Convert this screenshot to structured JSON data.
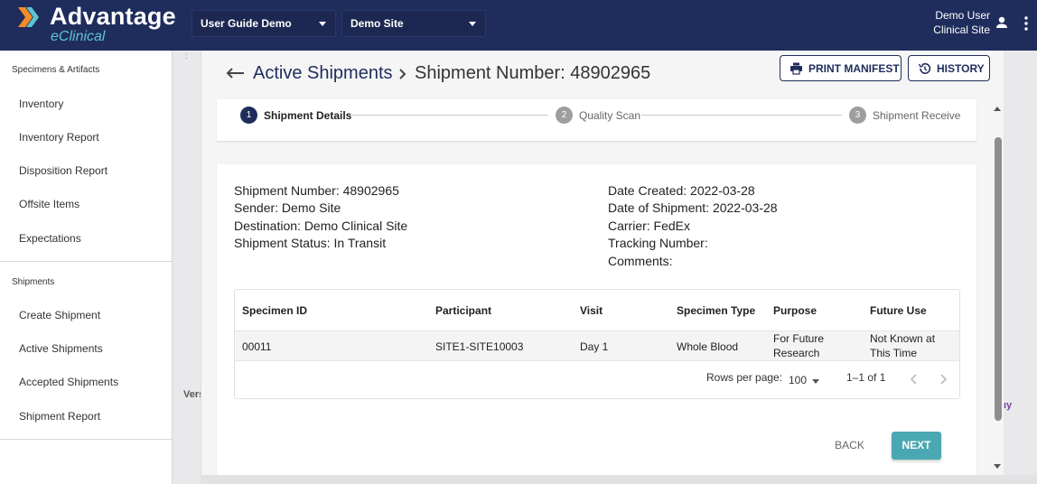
{
  "header": {
    "logo_main": "Advantage",
    "logo_sub": "eClinical",
    "study_select": "User Guide Demo",
    "site_select": "Demo Site",
    "user_name": "Demo User",
    "user_role": "Clinical Site",
    "bg_color": "#1f2d5c"
  },
  "sidebar": {
    "sections": [
      {
        "title": "Specimens & Artifacts",
        "items": [
          {
            "label": "Inventory"
          },
          {
            "label": "Inventory Report"
          },
          {
            "label": "Disposition Report"
          },
          {
            "label": "Offsite Items"
          },
          {
            "label": "Expectations"
          }
        ]
      },
      {
        "title": "Shipments",
        "items": [
          {
            "label": "Create Shipment"
          },
          {
            "label": "Active Shipments"
          },
          {
            "label": "Accepted Shipments"
          },
          {
            "label": "Shipment Report"
          }
        ]
      }
    ]
  },
  "page": {
    "breadcrumb_link": "Active Shipments",
    "title": "Shipment Number: 48902965",
    "print_button": "PRINT MANIFEST",
    "history_button": "HISTORY",
    "gutter_mark": ":",
    "version_fragment": "Vers",
    "edge_fragment": "ıy"
  },
  "stepper": {
    "steps": [
      {
        "number": "1",
        "label": "Shipment Details",
        "state": "active"
      },
      {
        "number": "2",
        "label": "Quality Scan",
        "state": "inactive"
      },
      {
        "number": "3",
        "label": "Shipment Receive",
        "state": "inactive"
      }
    ],
    "active_color": "#1f2d5c",
    "inactive_color": "#9e9e9e"
  },
  "details": {
    "shipment_number": "Shipment Number: 48902965",
    "sender": "Sender: Demo Site",
    "destination": "Destination: Demo Clinical Site",
    "status": "Shipment Status: In Transit",
    "date_created": "Date Created: 2022-03-28",
    "date_of_shipment": "Date of Shipment: 2022-03-28",
    "carrier": "Carrier: FedEx",
    "tracking_number": "Tracking Number:",
    "comments": "Comments:"
  },
  "table": {
    "columns": [
      "Specimen ID",
      "Participant",
      "Visit",
      "Specimen Type",
      "Purpose",
      "Future Use"
    ],
    "rows": [
      {
        "specimen_id": "00011",
        "participant": "SITE1-SITE10003",
        "visit": "Day 1",
        "specimen_type": "Whole Blood",
        "purpose": "For Future Research",
        "future_use": "Not Known at This Time"
      }
    ],
    "rows_per_page_label": "Rows per page:",
    "rows_per_page_value": "100",
    "range": "1–1 of 1"
  },
  "actions": {
    "back": "BACK",
    "next": "NEXT",
    "next_color": "#4aa8b2"
  }
}
